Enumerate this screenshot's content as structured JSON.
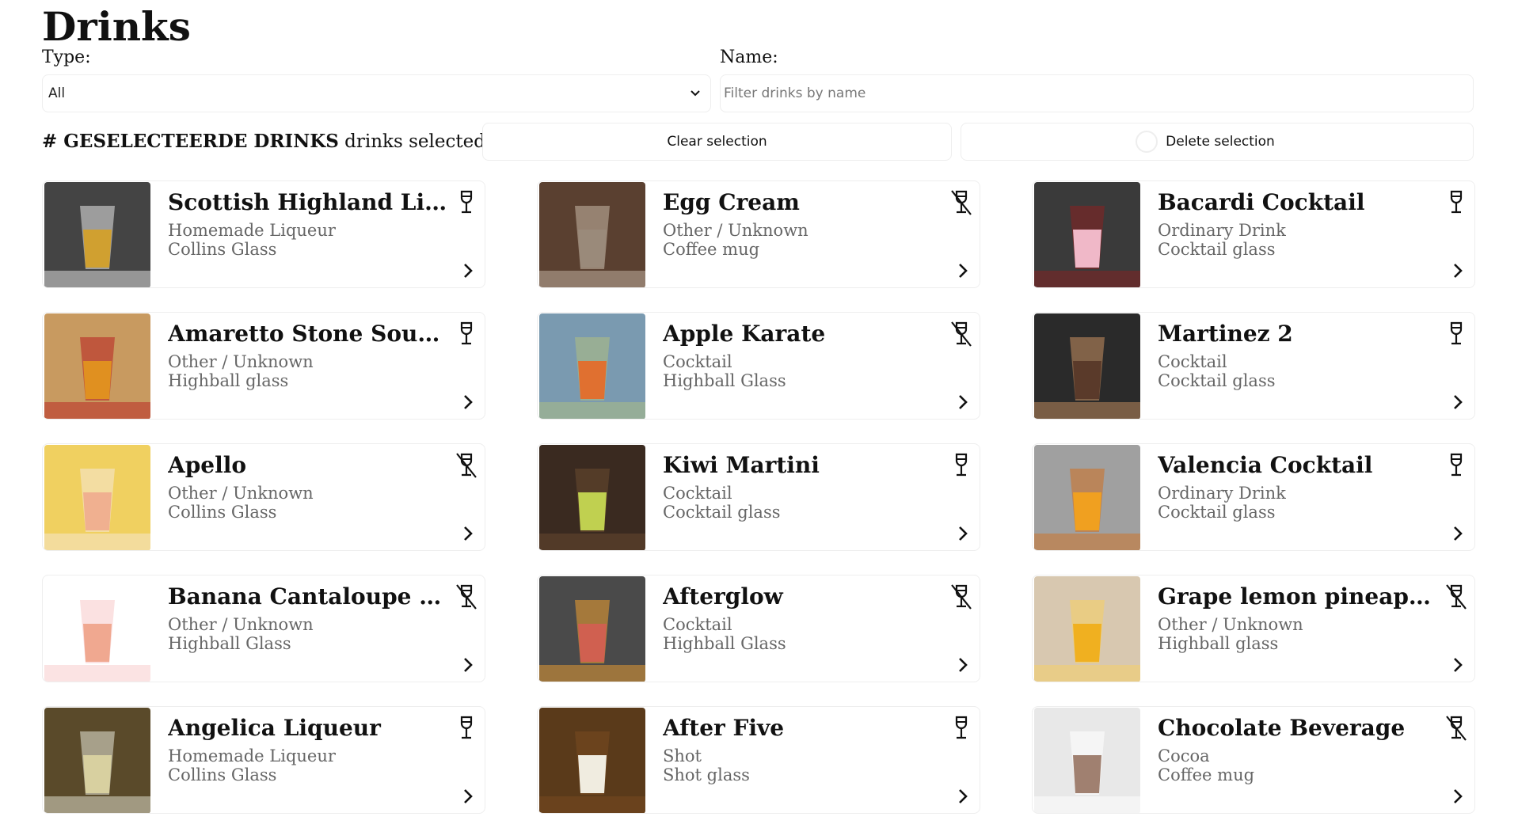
{
  "page": {
    "title": "Drinks"
  },
  "filters": {
    "type_label": "Type:",
    "type_value": "All",
    "name_label": "Name:",
    "name_placeholder": "Filter drinks by name",
    "name_value": ""
  },
  "selection": {
    "count_text": "# GESELECTEERDE DRINKS",
    "suffix": " drinks selected",
    "clear_label": "Clear selection",
    "delete_label": "Delete selection"
  },
  "colors": {
    "border": "#eeeeee",
    "muted_text": "#666666",
    "icon": "#111111"
  },
  "drinks": [
    {
      "name": "Scottish Highland Liq...",
      "category": "Homemade Liqueur",
      "glass": "Collins Glass",
      "alcoholic": true,
      "thumb": [
        "#444444",
        "#d0a030",
        "#e8e8e8"
      ]
    },
    {
      "name": "Egg Cream",
      "category": "Other / Unknown",
      "glass": "Coffee mug",
      "alcoholic": false,
      "thumb": [
        "#5a4030",
        "#9a8a7a",
        "#c8b8a8"
      ]
    },
    {
      "name": "Bacardi Cocktail",
      "category": "Ordinary Drink",
      "glass": "Cocktail glass",
      "alcoholic": true,
      "thumb": [
        "#3a3a3a",
        "#f0b8c8",
        "#8a2020"
      ]
    },
    {
      "name": "Amaretto Stone Sour ...",
      "category": "Other / Unknown",
      "glass": "Highball glass",
      "alcoholic": true,
      "thumb": [
        "#c89a60",
        "#e09020",
        "#b82020"
      ]
    },
    {
      "name": "Apple Karate",
      "category": "Cocktail",
      "glass": "Highball Glass",
      "alcoholic": false,
      "thumb": [
        "#7a9ab0",
        "#e07030",
        "#b0c080"
      ]
    },
    {
      "name": "Martinez 2",
      "category": "Cocktail",
      "glass": "Cocktail glass",
      "alcoholic": true,
      "thumb": [
        "#2a2a2a",
        "#5a3a2a",
        "#c89060"
      ]
    },
    {
      "name": "Apello",
      "category": "Other / Unknown",
      "glass": "Collins Glass",
      "alcoholic": false,
      "thumb": [
        "#f0d060",
        "#f0b090",
        "#f5e8d8"
      ]
    },
    {
      "name": "Kiwi Martini",
      "category": "Cocktail",
      "glass": "Cocktail glass",
      "alcoholic": true,
      "thumb": [
        "#3a2a20",
        "#c0d050",
        "#6a4a30"
      ]
    },
    {
      "name": "Valencia Cocktail",
      "category": "Ordinary Drink",
      "glass": "Cocktail glass",
      "alcoholic": true,
      "thumb": [
        "#a0a0a0",
        "#f0a020",
        "#d07020"
      ]
    },
    {
      "name": "Banana Cantaloupe S...",
      "category": "Other / Unknown",
      "glass": "Highball Glass",
      "alcoholic": false,
      "thumb": [
        "#ffffff",
        "#f0a890",
        "#f8c8c8"
      ]
    },
    {
      "name": "Afterglow",
      "category": "Cocktail",
      "glass": "Highball Glass",
      "alcoholic": false,
      "thumb": [
        "#4a4a4a",
        "#d06050",
        "#f0a030"
      ]
    },
    {
      "name": "Grape lemon pineappl...",
      "category": "Other / Unknown",
      "glass": "Highball glass",
      "alcoholic": false,
      "thumb": [
        "#d8c8b0",
        "#f0b020",
        "#f8d060"
      ]
    },
    {
      "name": "Angelica Liqueur",
      "category": "Homemade Liqueur",
      "glass": "Collins Glass",
      "alcoholic": true,
      "thumb": [
        "#5a4a2a",
        "#d8d0a0",
        "#e8e8d8"
      ]
    },
    {
      "name": "After Five",
      "category": "Shot",
      "glass": "Shot glass",
      "alcoholic": true,
      "thumb": [
        "#5a3a1a",
        "#f0ece0",
        "#7a4a20"
      ]
    },
    {
      "name": "Chocolate Beverage",
      "category": "Cocoa",
      "glass": "Coffee mug",
      "alcoholic": false,
      "thumb": [
        "#e8e8e8",
        "#a08070",
        "#ffffff"
      ]
    }
  ]
}
